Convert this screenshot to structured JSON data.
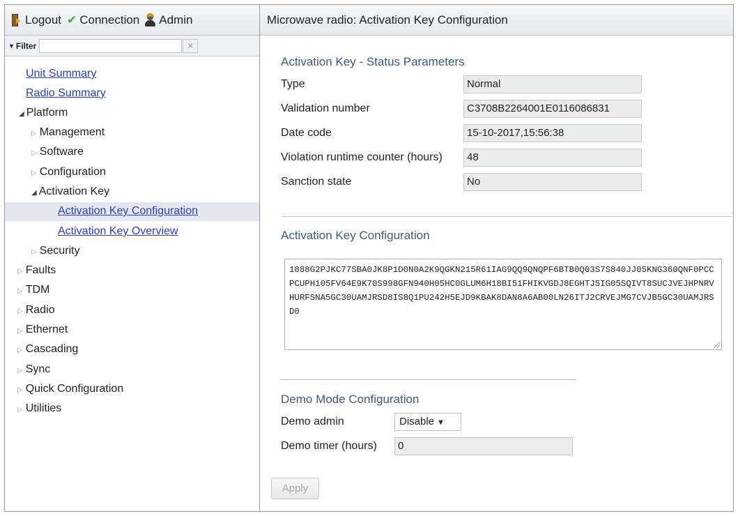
{
  "header": {
    "logout_label": "Logout",
    "connection_label": "Connection",
    "admin_label": "Admin",
    "icons": [
      "logout-icon",
      "connection-check-icon",
      "admin-user-icon"
    ],
    "check_color": "#4aa33a"
  },
  "filter": {
    "label": "Filter",
    "value": "",
    "clear_glyph": "×"
  },
  "nav": {
    "unit_summary": "Unit Summary",
    "radio_summary": "Radio Summary",
    "platform": "Platform",
    "management": "Management",
    "software": "Software",
    "configuration": "Configuration",
    "activation_key": "Activation Key",
    "activation_key_configuration": "Activation Key Configuration",
    "activation_key_overview": "Activation Key Overview",
    "security": "Security",
    "faults": "Faults",
    "tdm": "TDM",
    "radio": "Radio",
    "ethernet": "Ethernet",
    "cascading": "Cascading",
    "sync": "Sync",
    "quick_configuration": "Quick Configuration",
    "utilities": "Utilities",
    "selected_item": "Activation Key Configuration",
    "link_color": "#2a3fb0",
    "selected_bg": "#e3e7ef"
  },
  "main": {
    "title": "Microwave radio: Activation Key Configuration",
    "status": {
      "title": "Activation Key - Status Parameters",
      "type_label": "Type",
      "type_value": "Normal",
      "validation_label": "Validation number",
      "validation_value": "C3708B2264001E0116086831",
      "date_label": "Date code",
      "date_value": "15-10-2017,15:56:38",
      "violation_label": "Violation runtime counter (hours)",
      "violation_value": "48",
      "sanction_label": "Sanction state",
      "sanction_value": "No"
    },
    "key_config": {
      "title": "Activation Key Configuration",
      "key_text": "1888G2PJKC77SBA0JK8P1D0N0A2K9QGKN215R61IAG9QQ9QNQPF6BTB0Q03S7S840JJ05KNG360QNF0PCCPCUPH105FV64E9K70S998GFN940H05HC0GLUM6H18BI51FHIKVGDJ8EGHTJ5IG05SQIVT8SUCJVEJHPNRVHURFSNA5GC30UAMJRSD8IS8Q1PU242H5EJD9KBAK8DAN8A6AB00LN26ITJ2CRVEJMG7CVJB5GC30UAMJRSD0"
    },
    "demo": {
      "title": "Demo Mode Configuration",
      "admin_label": "Demo admin",
      "admin_value": "Disable",
      "timer_label": "Demo timer (hours)",
      "timer_value": "0"
    },
    "apply_label": "Apply",
    "section_title_color": "#3d5a7a"
  }
}
